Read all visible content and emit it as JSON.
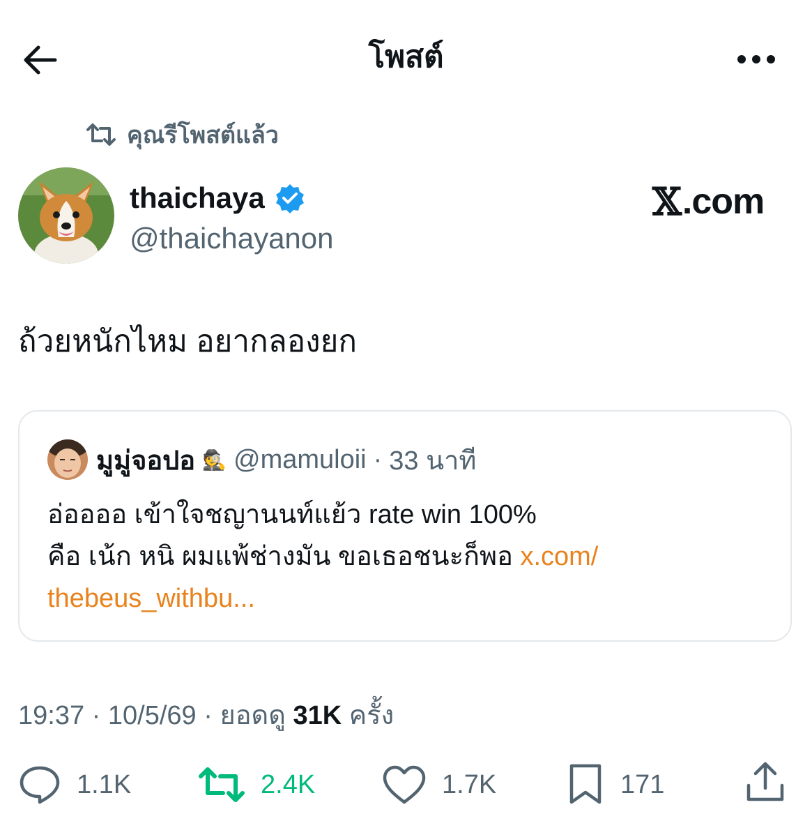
{
  "header": {
    "title": "โพสต์",
    "back_icon": "arrow-left-icon",
    "more_icon": "more-horizontal-icon"
  },
  "repost": {
    "label": "คุณรีโพสต์แล้ว",
    "icon": "repost-icon"
  },
  "author": {
    "name": "thaichaya",
    "handle": "@thaichayanon",
    "verified": true,
    "verified_color": "#1d9bf0",
    "avatar_icon": "corgi-avatar"
  },
  "watermark": {
    "x_glyph": "𝕏",
    "domain": ".com"
  },
  "post": {
    "text": "ถ้วยหนักไหม อยากลองยก"
  },
  "quote": {
    "name": "มูมู่จอปอ",
    "emoji": "🕵",
    "handle": "@mamuloii",
    "dot": "·",
    "time": "33 นาที",
    "line1": "อ่ออออ เข้าใจชญานนท์แย้ว rate win 100%",
    "line2_text": "คือ เน้ก หนิ ผมแพ้ช่างมัน ขอเธอชนะก็พอ ",
    "link_part1": "x.com/",
    "link_part2": "thebeus_withbu...",
    "link_color": "#e8821c"
  },
  "meta": {
    "time": "19:37",
    "dot1": " · ",
    "date": "10/5/69",
    "dot2": " · ",
    "views_label": "ยอดดู ",
    "views_count": "31K",
    "views_suffix": " ครั้ง"
  },
  "actions": {
    "reply": {
      "icon": "reply-icon",
      "count": "1.1K"
    },
    "retweet": {
      "icon": "retweet-icon",
      "count": "2.4K",
      "active": true,
      "color": "#00ba7c"
    },
    "like": {
      "icon": "heart-icon",
      "count": "1.7K"
    },
    "bookmark": {
      "icon": "bookmark-icon",
      "count": "171"
    },
    "share": {
      "icon": "share-icon"
    }
  },
  "colors": {
    "text_primary": "#0f1419",
    "text_secondary": "#536471",
    "border": "#e4e8eb",
    "background": "#ffffff"
  }
}
